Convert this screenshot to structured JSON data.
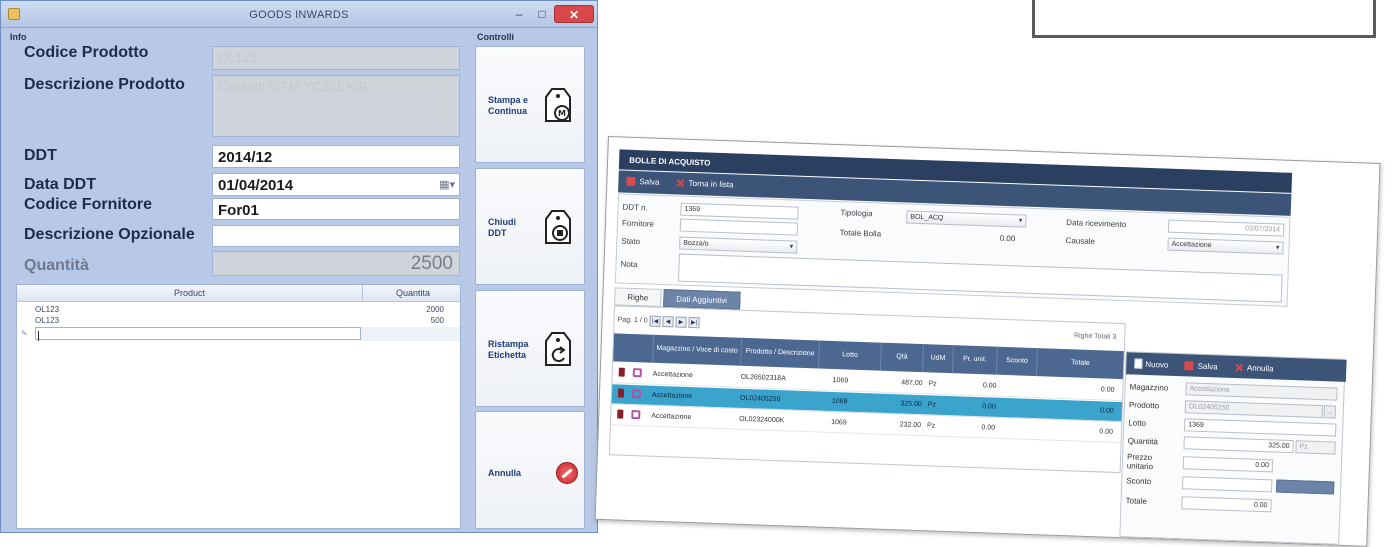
{
  "goods_inwards": {
    "title": "GOODS INWARDS",
    "window_controls": {
      "minimize": "–",
      "maximize": "□",
      "close": "✕"
    },
    "info_label": "Info",
    "controls_label": "Controlli",
    "fields": {
      "codice_prodotto_label": "Codice Prodotto",
      "codice_prodotto_value": "OL123",
      "descrizione_prodotto_label": "Descrizione Prodotto",
      "descrizione_prodotto_value": "Cassetti ISTM YC251 KIR",
      "ddt_label": "DDT",
      "ddt_value": "2014/12",
      "data_ddt_label": "Data DDT",
      "data_ddt_value": "01/04/2014",
      "codice_fornitore_label": "Codice Fornitore",
      "codice_fornitore_value": "For01",
      "descrizione_opzionale_label": "Descrizione Opzionale",
      "descrizione_opzionale_value": "",
      "quantita_label": "Quantità",
      "quantita_value": "2500"
    },
    "grid": {
      "col_product": "Product",
      "col_quantity": "Quantita",
      "rows": [
        {
          "product": "OL123",
          "quantity": "2000"
        },
        {
          "product": "OL123",
          "quantity": "500"
        }
      ]
    },
    "buttons": {
      "stampa": "Stampa e Continua",
      "chiudi": "Chiudi DDT",
      "ristampa": "Ristampa Etichetta",
      "annulla": "Annulla"
    }
  },
  "bolle": {
    "title": "BOLLE DI ACQUISTO",
    "toolbar": {
      "save": "Salva",
      "back": "Torna in lista"
    },
    "header": {
      "ddt_label": "DDT n.",
      "ddt_value": "1369",
      "fornitore_label": "Fornitore",
      "stato_label": "Stato",
      "stato_value": "Bozza/o",
      "nota_label": "Nota",
      "tipologia_label": "Tipologia",
      "tipologia_value": "BOL_ACQ",
      "totale_label": "Totale Bolla",
      "totale_value": "0.00",
      "data_label": "Data ricevimento",
      "data_value": "03/07/2014",
      "causale_label": "Causale",
      "causale_value": "Accettazione"
    },
    "tabs": [
      "Righe",
      "Dati Aggiuntivi"
    ],
    "pager": {
      "label": "Pag. 1 / 0",
      "buttons": [
        "|◀",
        "◀",
        "▶",
        "▶|"
      ],
      "total": "Righe Totali 3"
    },
    "columns": [
      "Magazzino / Voce di costo",
      "Prodotto / Descrizione",
      "Lotto",
      "Qtà",
      "UdM",
      "Pr. unit.",
      "Sconto",
      "Totale"
    ],
    "rows": [
      {
        "mag": "Accettazione",
        "prod": "OL26502318A",
        "lotto": "1069",
        "qta": "487.00",
        "udm": "Pz",
        "prezzo": "0.00",
        "totale": "0.00",
        "selected": false
      },
      {
        "mag": "Accettazione",
        "prod": "OL02405250",
        "lotto": "1069",
        "qta": "325.00",
        "udm": "Pz",
        "prezzo": "0.00",
        "totale": "0.00",
        "selected": true
      },
      {
        "mag": "Accettazione",
        "prod": "OL02324000K",
        "lotto": "1069",
        "qta": "232.00",
        "udm": "Pz",
        "prezzo": "0.00",
        "totale": "0.00",
        "selected": false
      }
    ],
    "side": {
      "toolbar": {
        "new": "Nuovo",
        "save": "Salva",
        "cancel": "Annulla"
      },
      "magazzino_label": "Magazzino",
      "magazzino_value": "Accettazione",
      "prodotto_label": "Prodotto",
      "prodotto_value": "OL02405250",
      "lotto_label": "Lotto",
      "lotto_value": "1369",
      "quantita_label": "Quantità",
      "quantita_value": "325.00",
      "quantita_unit": "Pz",
      "prezzo_label": "Prezzo unitario",
      "prezzo_value": "0.00",
      "sconto_label": "Sconto",
      "totale_label": "Totale",
      "totale_value": "0.00"
    }
  }
}
